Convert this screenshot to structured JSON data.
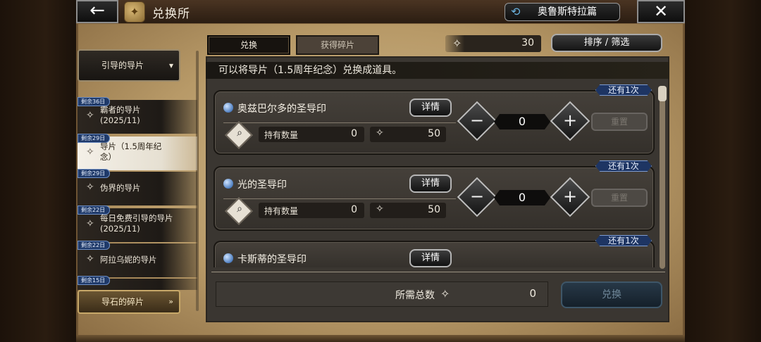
{
  "header": {
    "back_label": "←",
    "title": "兑换所",
    "story_button": "奥鲁斯特拉篇",
    "close_label": "✕"
  },
  "sidebar": {
    "category_header": "引导的导片",
    "category_footer": "导石的碎片",
    "items": [
      {
        "badge": "剩余36日",
        "label": "霸者的导片 (2025/11)"
      },
      {
        "badge": "剩余29日",
        "label": "导片（1.5周年纪念）",
        "selected": true
      },
      {
        "badge": "剩余29日",
        "label": "伪界的导片"
      },
      {
        "badge": "剩余22日",
        "label": "每日免费引导的导片(2025/11)"
      },
      {
        "badge": "剩余22日",
        "label": "阿拉乌妮的导片"
      },
      {
        "badge": "剩余15日",
        "label": ""
      }
    ]
  },
  "tabs": {
    "exchange": "兑换",
    "fragments": "获得碎片"
  },
  "currency": {
    "value": "30"
  },
  "sort_filter_label": "排序 / 筛选",
  "description": "可以将导片（1.5周年纪念）兑换成道具。",
  "items": [
    {
      "name": "奥兹巴尔多的圣导印",
      "detail_label": "详情",
      "held_label": "持有数量",
      "held_value": "0",
      "cost": "50",
      "quantity": "0",
      "reset_label": "重置",
      "limit": "还有1次"
    },
    {
      "name": "光的圣导印",
      "detail_label": "详情",
      "held_label": "持有数量",
      "held_value": "0",
      "cost": "50",
      "quantity": "0",
      "reset_label": "重置",
      "limit": "还有1次"
    },
    {
      "name": "卡斯蒂的圣导印",
      "detail_label": "详情",
      "limit": "还有1次"
    }
  ],
  "footer": {
    "total_label": "所需总数",
    "total_value": "0",
    "exchange_button": "兑换"
  },
  "colors": {
    "badge_blue": "#1e3563",
    "panel": "#3a3631",
    "parchment": "#b89a68"
  }
}
